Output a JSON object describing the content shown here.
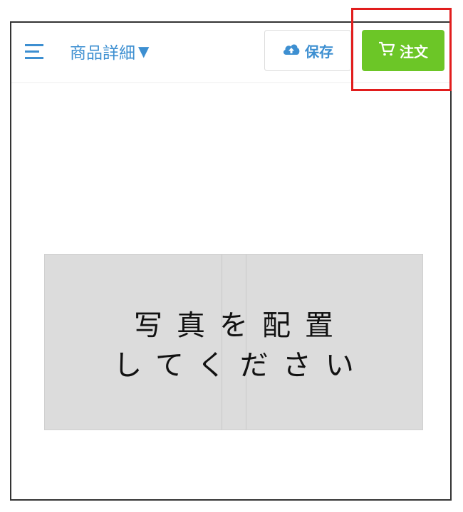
{
  "header": {
    "title": "商品詳細",
    "caret_icon": "▼",
    "menu_icon": "hamburger-menu-icon",
    "save": {
      "label": "保存",
      "icon": "cloud-upload-icon"
    },
    "order": {
      "label": "注文",
      "icon": "cart-icon"
    }
  },
  "main": {
    "placeholder_line1": "写真を配置",
    "placeholder_line2": "してください"
  },
  "colors": {
    "accent_blue": "#3d8fd1",
    "order_green": "#6cc627",
    "highlight_red": "#e11d1d",
    "placeholder_gray": "#dcdcdc"
  }
}
